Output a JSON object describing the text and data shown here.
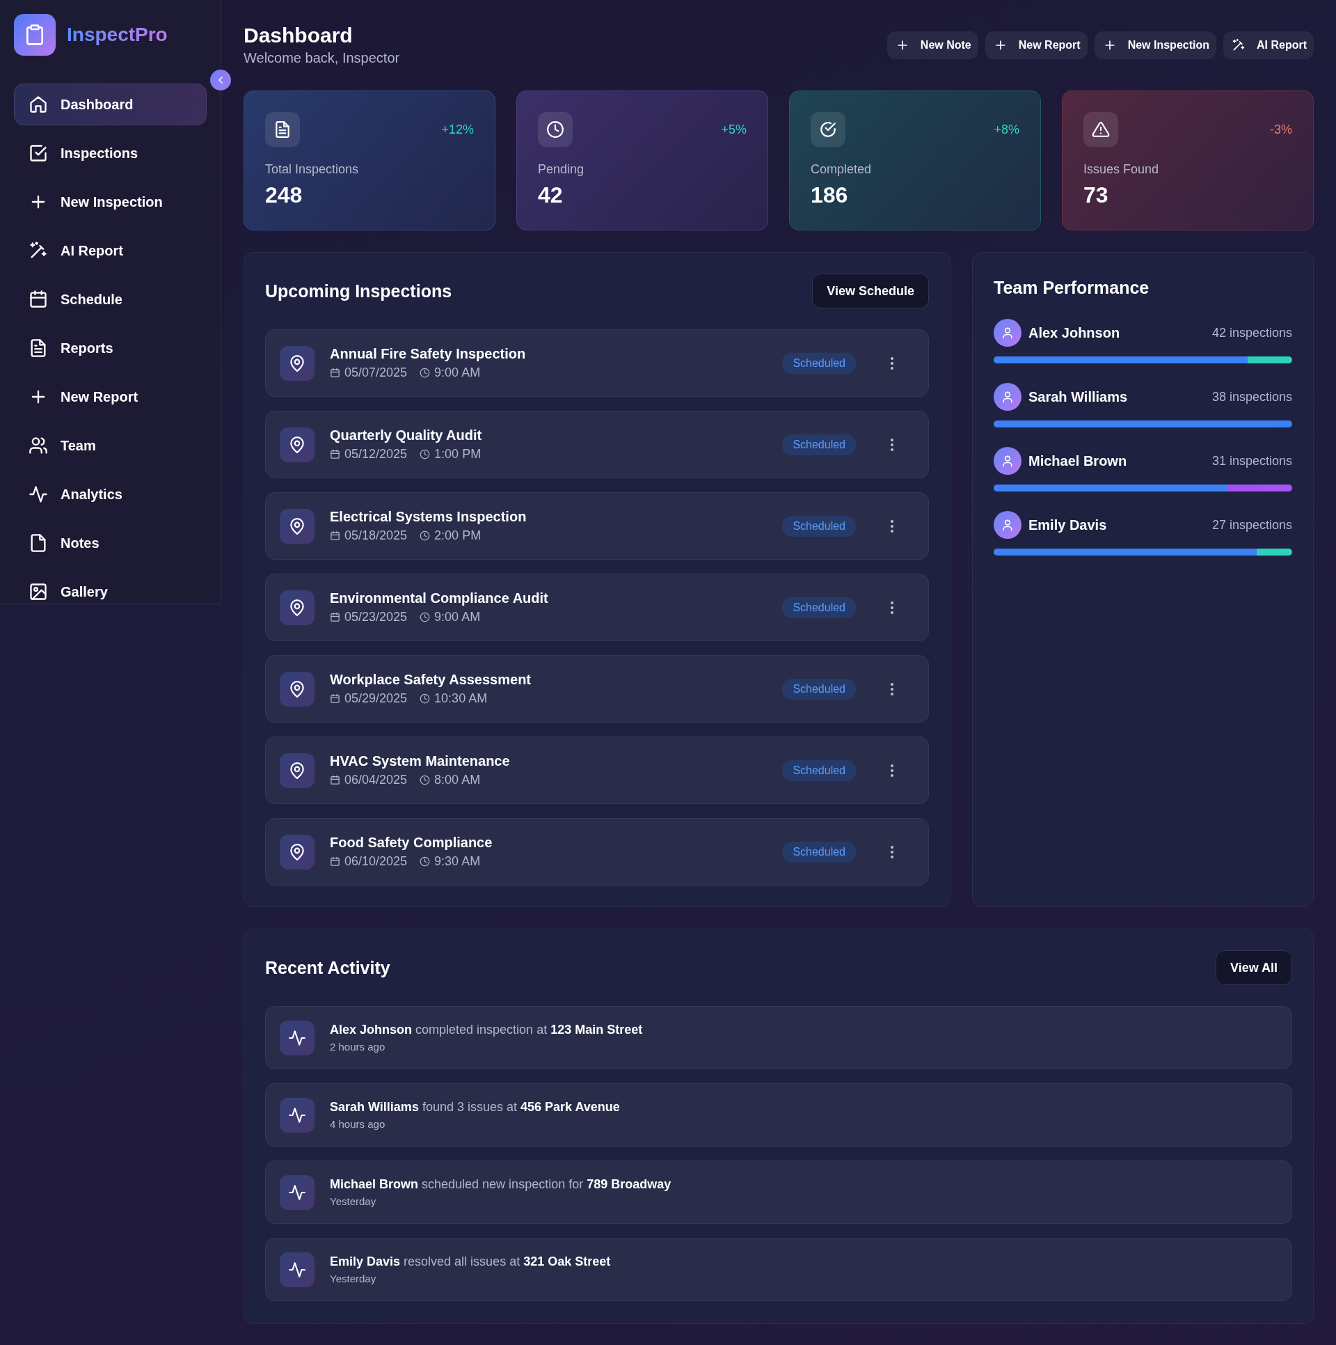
{
  "brand": {
    "name": "InspectPro"
  },
  "sidebar": {
    "items": [
      {
        "label": "Dashboard",
        "selected": true
      },
      {
        "label": "Inspections",
        "selected": false
      },
      {
        "label": "New Inspection",
        "selected": false
      },
      {
        "label": "AI Report",
        "selected": false
      },
      {
        "label": "Schedule",
        "selected": false
      },
      {
        "label": "Reports",
        "selected": false
      },
      {
        "label": "New Report",
        "selected": false
      },
      {
        "label": "Team",
        "selected": false
      },
      {
        "label": "Analytics",
        "selected": false
      },
      {
        "label": "Notes",
        "selected": false
      },
      {
        "label": "Gallery",
        "selected": false
      }
    ]
  },
  "header": {
    "title": "Dashboard",
    "subtitle": "Welcome back, Inspector",
    "actions": [
      {
        "label": "New Note",
        "kind": "plus"
      },
      {
        "label": "New Report",
        "kind": "plus"
      },
      {
        "label": "New Inspection",
        "kind": "plus"
      },
      {
        "label": "AI Report",
        "kind": "wand"
      }
    ]
  },
  "stats": [
    {
      "label": "Total Inspections",
      "value": "248",
      "trend": {
        "text": "+12%",
        "color": "#2dd4bf"
      },
      "kind": "document",
      "color": "#2f4a86"
    },
    {
      "label": "Pending",
      "value": "42",
      "trend": {
        "text": "+5%",
        "color": "#2dd4bf"
      },
      "kind": "clock",
      "color": "#4b3a80"
    },
    {
      "label": "Completed",
      "value": "186",
      "trend": {
        "text": "+8%",
        "color": "#2dd4bf"
      },
      "kind": "check",
      "color": "#1f5a62"
    },
    {
      "label": "Issues Found",
      "value": "73",
      "trend": {
        "text": "-3%",
        "color": "#f87171"
      },
      "kind": "warning",
      "color": "#6a2f45"
    }
  ],
  "upcoming": {
    "title": "Upcoming Inspections",
    "button": "View Schedule",
    "items": [
      {
        "title": "Annual Fire Safety Inspection",
        "date": "05/07/2025",
        "time": "9:00 AM",
        "status": "Scheduled"
      },
      {
        "title": "Quarterly Quality Audit",
        "date": "05/12/2025",
        "time": "1:00 PM",
        "status": "Scheduled"
      },
      {
        "title": "Electrical Systems Inspection",
        "date": "05/18/2025",
        "time": "2:00 PM",
        "status": "Scheduled"
      },
      {
        "title": "Environmental Compliance Audit",
        "date": "05/23/2025",
        "time": "9:00 AM",
        "status": "Scheduled"
      },
      {
        "title": "Workplace Safety Assessment",
        "date": "05/29/2025",
        "time": "10:30 AM",
        "status": "Scheduled"
      },
      {
        "title": "HVAC System Maintenance",
        "date": "06/04/2025",
        "time": "8:00 AM",
        "status": "Scheduled"
      },
      {
        "title": "Food Safety Compliance",
        "date": "06/10/2025",
        "time": "9:30 AM",
        "status": "Scheduled"
      }
    ]
  },
  "team": {
    "title": "Team Performance",
    "members": [
      {
        "name": "Alex Johnson",
        "count": "42 inspections",
        "level": 0.85,
        "color": "#2dd4bf"
      },
      {
        "name": "Sarah Williams",
        "count": "38 inspections",
        "level": 0.95,
        "color": "#3b82f6"
      },
      {
        "name": "Michael Brown",
        "count": "31 inspections",
        "level": 0.78,
        "color": "#a855f7"
      },
      {
        "name": "Emily Davis",
        "count": "27 inspections",
        "level": 0.88,
        "color": "#2dd4bf"
      }
    ]
  },
  "activity": {
    "title": "Recent Activity",
    "button": "View All",
    "items": [
      {
        "text": "**Alex Johnson** completed inspection at **123 Main Street**",
        "time": "2 hours ago"
      },
      {
        "text": "**Sarah Williams** found 3 issues at **456 Park Avenue**",
        "time": "4 hours ago"
      },
      {
        "text": "**Michael Brown** scheduled new inspection for **789 Broadway**",
        "time": "Yesterday"
      },
      {
        "text": "**Emily Davis** resolved all issues at **321 Oak Street**",
        "time": "Yesterday"
      }
    ]
  }
}
